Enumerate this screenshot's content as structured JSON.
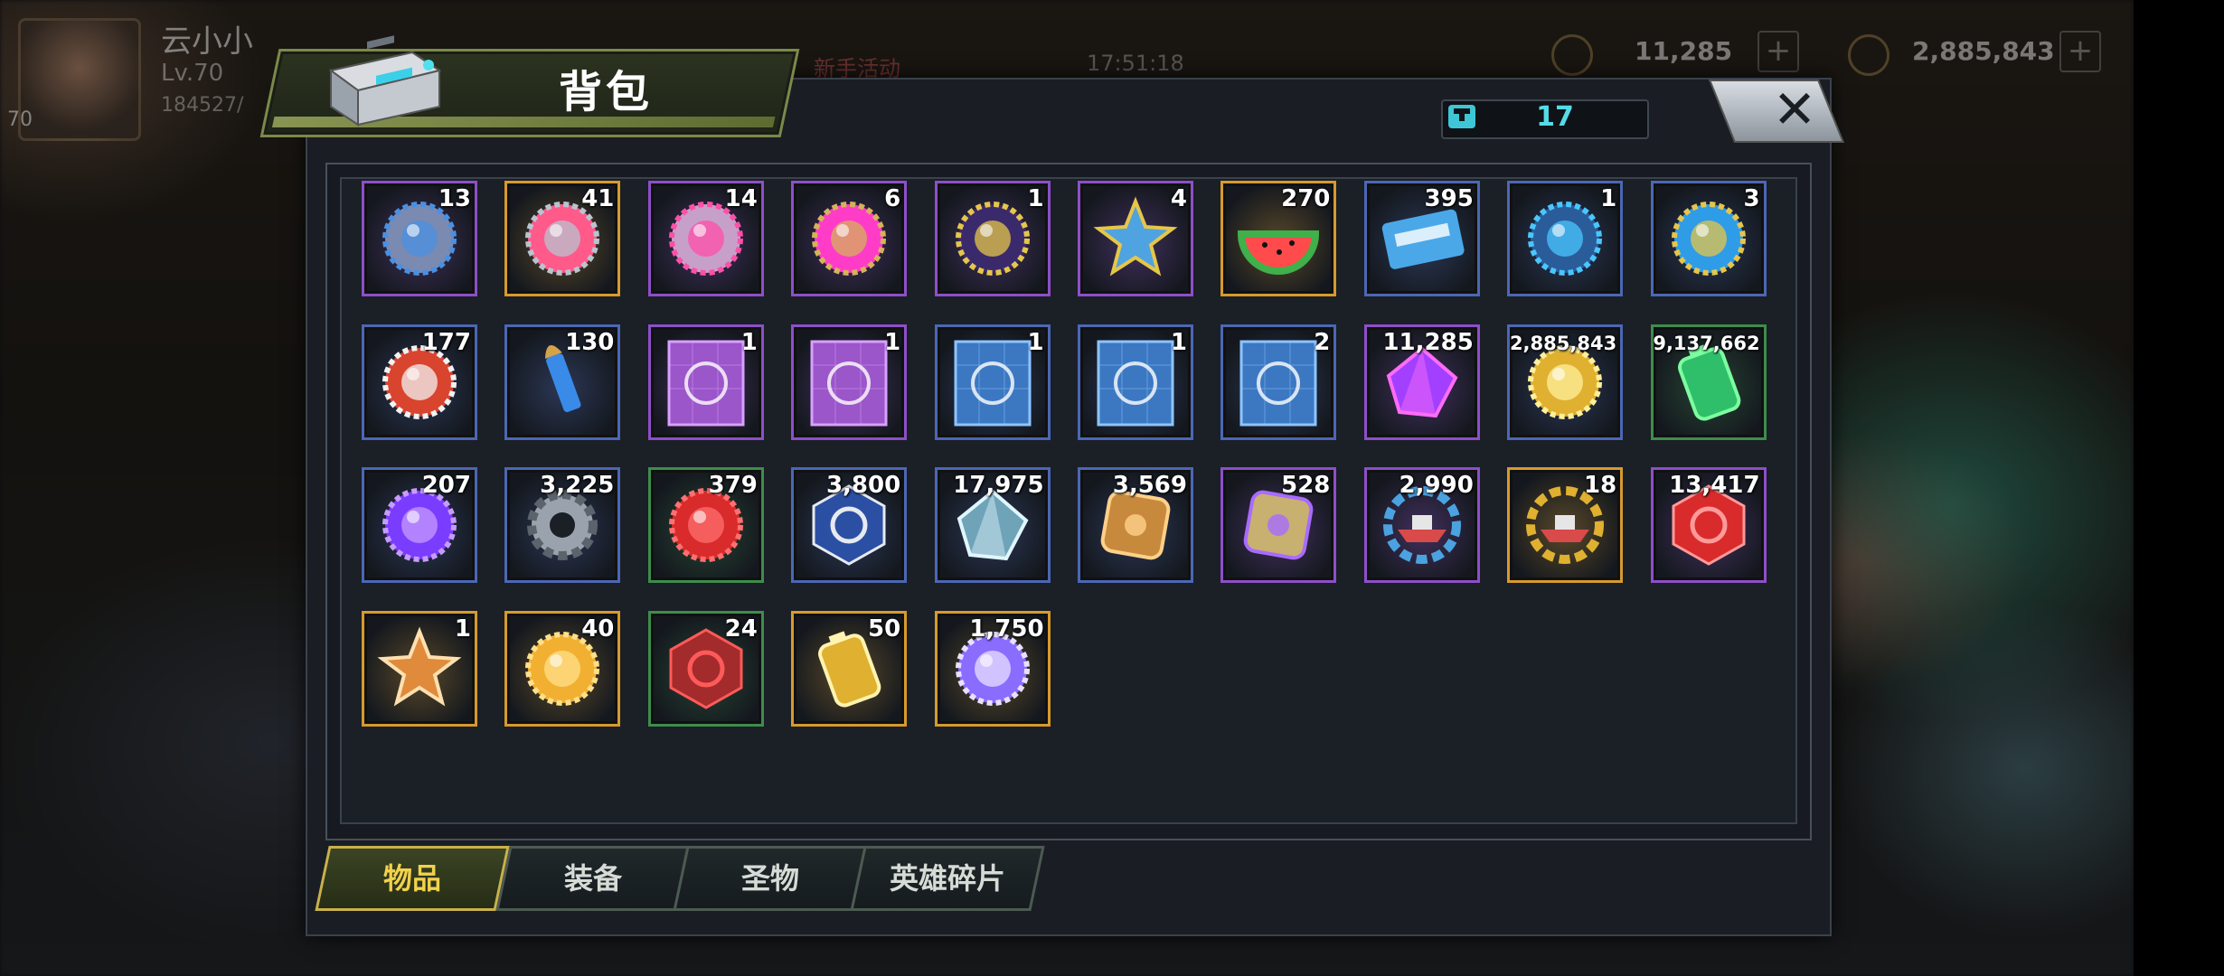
{
  "background_hud": {
    "player_name": "云小小",
    "level": "Lv.70",
    "exp": "184527/",
    "avatar_level": "70",
    "event": "新手活动",
    "time": "17:51:18",
    "resource_1": "11,285",
    "resource_2": "2,885,843"
  },
  "window": {
    "title": "背包",
    "capacity": "17",
    "close_icon": "close-icon"
  },
  "items": [
    {
      "count": "13",
      "icon": "mech-part-icon",
      "rarity": "#8c4fc9"
    },
    {
      "count": "41",
      "icon": "pink-bottlecap-icon",
      "rarity": "#d69a2e"
    },
    {
      "count": "14",
      "icon": "film-reel-icon",
      "rarity": "#8c4fc9"
    },
    {
      "count": "6",
      "icon": "s-bottlecap-icon",
      "rarity": "#8c4fc9"
    },
    {
      "count": "1",
      "icon": "spade-chip-icon",
      "rarity": "#8c4fc9"
    },
    {
      "count": "4",
      "icon": "police-badge-icon",
      "rarity": "#8c4fc9"
    },
    {
      "count": "270",
      "icon": "watermelon-icon",
      "rarity": "#d69a2e"
    },
    {
      "count": "395",
      "icon": "cinema-ticket-icon",
      "rarity": "#4b67b5"
    },
    {
      "count": "1",
      "icon": "timer-icon",
      "rarity": "#4b67b5"
    },
    {
      "count": "3",
      "icon": "b-bottlecap-icon",
      "rarity": "#4b67b5"
    },
    {
      "count": "177",
      "icon": "red-chip-icon",
      "rarity": "#4b67b5"
    },
    {
      "count": "130",
      "icon": "bullet-icon",
      "rarity": "#4b67b5"
    },
    {
      "count": "1",
      "icon": "tshirt-blueprint-icon",
      "rarity": "#8c4fc9"
    },
    {
      "count": "1",
      "icon": "hat-blueprint-icon",
      "rarity": "#8c4fc9"
    },
    {
      "count": "1",
      "icon": "weapon-blueprint-icon",
      "rarity": "#4b67b5"
    },
    {
      "count": "1",
      "icon": "shirt-blueprint-icon",
      "rarity": "#4b67b5"
    },
    {
      "count": "2",
      "icon": "accessory-blueprint-icon",
      "rarity": "#4b67b5"
    },
    {
      "count": "11,285",
      "icon": "purple-crystal-icon",
      "rarity": "#8c4fc9"
    },
    {
      "count": "2,885,843",
      "icon": "gold-coins-icon",
      "rarity": "#4b67b5"
    },
    {
      "count": "9,137,662",
      "icon": "green-battery-icon",
      "rarity": "#3e8c4c"
    },
    {
      "count": "207",
      "icon": "purple-orb-icon",
      "rarity": "#4b67b5"
    },
    {
      "count": "3,225",
      "icon": "gear-icon",
      "rarity": "#4b67b5"
    },
    {
      "count": "379",
      "icon": "red-node-icon",
      "rarity": "#3e8c4c"
    },
    {
      "count": "3,800",
      "icon": "eye-mask-icon",
      "rarity": "#4b67b5"
    },
    {
      "count": "17,975",
      "icon": "prism-icon",
      "rarity": "#4b67b5"
    },
    {
      "count": "3,569",
      "icon": "fist-icon",
      "rarity": "#4b67b5"
    },
    {
      "count": "528",
      "icon": "puzzle-icon",
      "rarity": "#8c4fc9"
    },
    {
      "count": "2,990",
      "icon": "boat-gear-icon",
      "rarity": "#8c4fc9"
    },
    {
      "count": "18",
      "icon": "gold-boat-gear-icon",
      "rarity": "#d69a2e"
    },
    {
      "count": "13,417",
      "icon": "red-rune-icon",
      "rarity": "#8c4fc9"
    },
    {
      "count": "1",
      "icon": "star-arrow-icon",
      "rarity": "#d69a2e"
    },
    {
      "count": "40",
      "icon": "gold-coin-stack-icon",
      "rarity": "#d69a2e"
    },
    {
      "count": "24",
      "icon": "red-target-icon",
      "rarity": "#3e8c4c"
    },
    {
      "count": "50",
      "icon": "gold-canister-icon",
      "rarity": "#d69a2e"
    },
    {
      "count": "1,750",
      "icon": "armor-orb-icon",
      "rarity": "#d69a2e"
    }
  ],
  "tabs": [
    {
      "label": "物品",
      "active": true
    },
    {
      "label": "装备",
      "active": false
    },
    {
      "label": "圣物",
      "active": false
    },
    {
      "label": "英雄碎片",
      "active": false
    }
  ]
}
